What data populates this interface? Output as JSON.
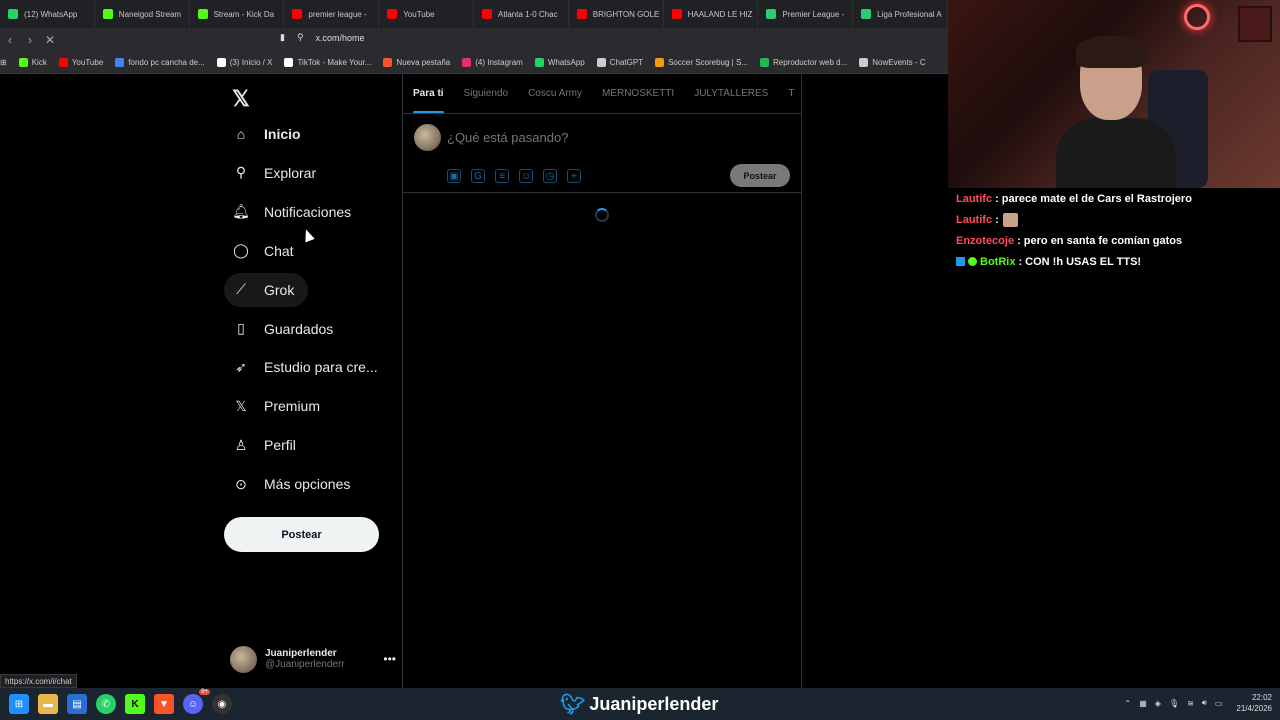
{
  "browser": {
    "tabs": [
      {
        "label": "(12) WhatsApp",
        "color": "#25d366"
      },
      {
        "label": "Naneigod Stream",
        "color": "#53fc18"
      },
      {
        "label": "Stream - Kick Da",
        "color": "#53fc18"
      },
      {
        "label": "premier league -",
        "color": "#ff0000"
      },
      {
        "label": "YouTube",
        "color": "#ff0000"
      },
      {
        "label": "Atlanta 1-0 Chac",
        "color": "#ff0000"
      },
      {
        "label": "BRIGHTON GOLE",
        "color": "#ff0000"
      },
      {
        "label": "HAALAND LE HIZ",
        "color": "#ff0000"
      },
      {
        "label": "Premier League -",
        "color": "#2ecc71"
      },
      {
        "label": "Liga Profesional A",
        "color": "#2ecc71"
      }
    ],
    "url": "x.com/home",
    "bookmarks": [
      {
        "label": "Kick",
        "color": "#53fc18"
      },
      {
        "label": "YouTube",
        "color": "#ff0000"
      },
      {
        "label": "fondo pc cancha de...",
        "color": "#4285f4"
      },
      {
        "label": "(3) Inicio / X",
        "color": "#ffffff"
      },
      {
        "label": "TikTok - Make Your...",
        "color": "#ffffff"
      },
      {
        "label": "Nueva pestaña",
        "color": "#fb542b"
      },
      {
        "label": "(4) Instagram",
        "color": "#e1306c"
      },
      {
        "label": "WhatsApp",
        "color": "#25d366"
      },
      {
        "label": "ChatGPT",
        "color": "#cccccc"
      },
      {
        "label": "Soccer Scorebug | S...",
        "color": "#f39c12"
      },
      {
        "label": "Reproductor web d...",
        "color": "#1db954"
      },
      {
        "label": "NowEvents - C",
        "color": "#cccccc"
      }
    ],
    "status_url": "https://x.com/i/chat"
  },
  "sidebar": {
    "items": [
      {
        "label": "Inicio",
        "icon": "home-icon"
      },
      {
        "label": "Explorar",
        "icon": "search-icon"
      },
      {
        "label": "Notificaciones",
        "icon": "bell-icon"
      },
      {
        "label": "Chat",
        "icon": "chat-bubble-icon"
      },
      {
        "label": "Grok",
        "icon": "grok-icon"
      },
      {
        "label": "Guardados",
        "icon": "bookmark-icon"
      },
      {
        "label": "Estudio para cre...",
        "icon": "rocket-icon"
      },
      {
        "label": "Premium",
        "icon": "x-logo-icon"
      },
      {
        "label": "Perfil",
        "icon": "person-icon"
      },
      {
        "label": "Más opciones",
        "icon": "more-circle-icon"
      }
    ],
    "post_label": "Postear",
    "account": {
      "name": "Juaniperlender",
      "handle": "@Juaniperlenderr"
    }
  },
  "feed": {
    "tabs": [
      "Para ti",
      "Siguiendo",
      "Coscu Army",
      "MERNOSKETTI",
      "JULYTALLERES",
      "T"
    ],
    "composer_placeholder": "¿Qué está pasando?",
    "post_label": "Postear"
  },
  "stream": {
    "chat": [
      {
        "user": "Lautifc",
        "text": ": parece mate el de Cars el Rastrojero",
        "color": "#ff4d5a"
      },
      {
        "user": "Lautifc",
        "text": ":",
        "color": "#ff4d5a",
        "emote": true
      },
      {
        "user": "Enzotecoje",
        "text": ": pero en santa fe comían gatos",
        "color": "#ff4d5a"
      },
      {
        "user": "BotRix",
        "text": ": CON !h USAS EL TTS!",
        "color": "#53fc18",
        "badges": true
      }
    ],
    "overlay_name": "Juaniperlender"
  },
  "taskbar": {
    "time": "22:02",
    "date": "21/4/2026",
    "badge_count": "9+"
  }
}
